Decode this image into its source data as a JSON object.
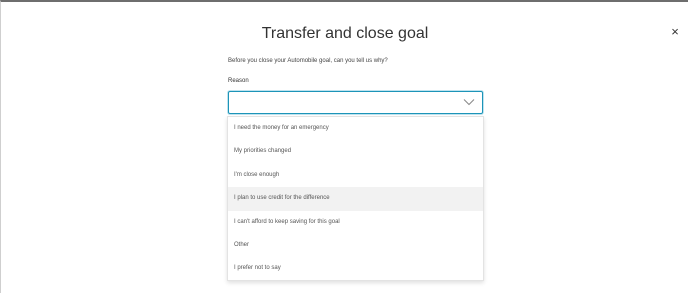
{
  "modal": {
    "title": "Transfer and close goal",
    "close_symbol": "×",
    "prompt": "Before you close your Automobile goal, can you tell us why?"
  },
  "reason_field": {
    "label": "Reason",
    "value": "",
    "icon": "chevron-down-icon",
    "border_color": "#1d94b8"
  },
  "reason_options": [
    {
      "label": "I need the money for an emergency",
      "highlighted": false
    },
    {
      "label": "My priorities changed",
      "highlighted": false
    },
    {
      "label": "I'm close enough",
      "highlighted": false
    },
    {
      "label": "I plan to use credit for the difference",
      "highlighted": true
    },
    {
      "label": "I can't afford to keep saving for this goal",
      "highlighted": false
    },
    {
      "label": "Other",
      "highlighted": false
    },
    {
      "label": "I prefer not to say",
      "highlighted": false
    }
  ]
}
